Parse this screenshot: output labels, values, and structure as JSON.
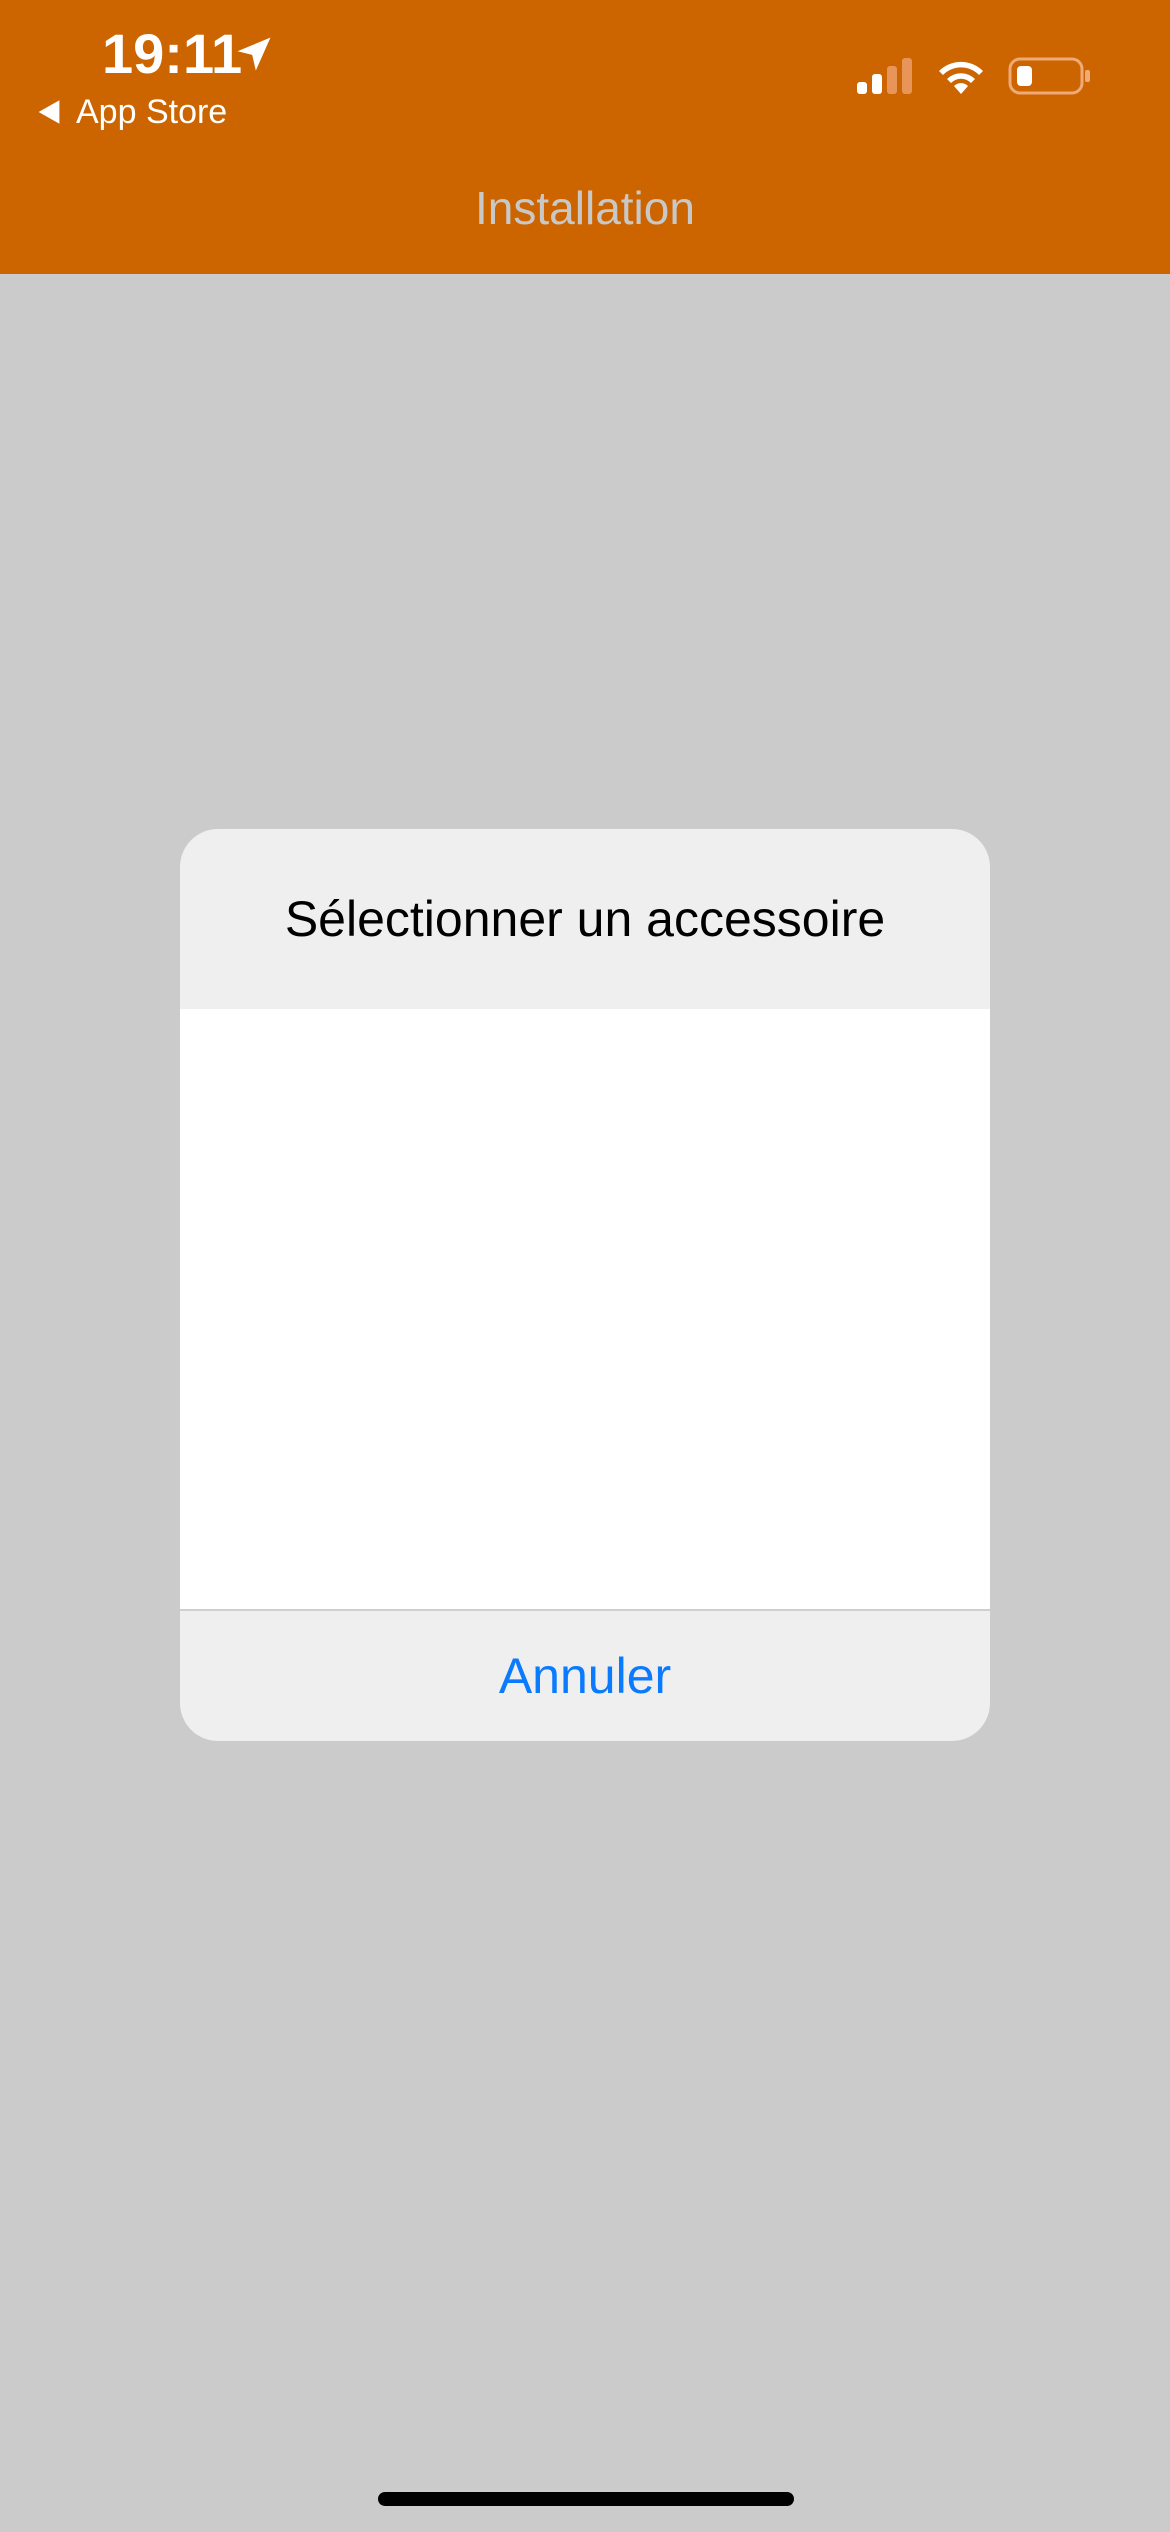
{
  "status_bar": {
    "time": "19:11",
    "back_label": "App Store",
    "signal_strength": 2,
    "battery_level": 0.2
  },
  "nav": {
    "title": "Installation"
  },
  "dialog": {
    "title": "Sélectionner un accessoire",
    "cancel_label": "Annuler"
  },
  "colors": {
    "accent": "#cc6400",
    "link": "#0a7aff",
    "backdrop": "#cbcbcb"
  }
}
